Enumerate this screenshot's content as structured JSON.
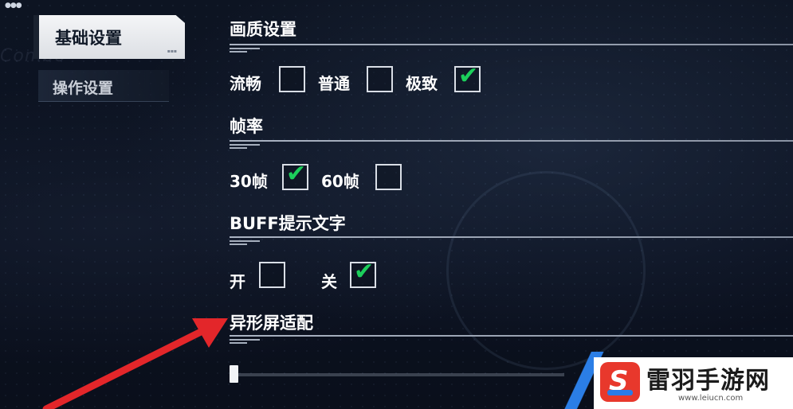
{
  "sidebar": {
    "items": [
      {
        "label": "基础设置",
        "active": true
      },
      {
        "label": "操作设置",
        "active": false
      }
    ]
  },
  "settings": {
    "quality": {
      "title": "画质设置",
      "options": [
        {
          "label": "流畅",
          "checked": false
        },
        {
          "label": "普通",
          "checked": false
        },
        {
          "label": "极致",
          "checked": true
        }
      ]
    },
    "framerate": {
      "title": "帧率",
      "options": [
        {
          "label": "30帧",
          "checked": true
        },
        {
          "label": "60帧",
          "checked": false
        }
      ]
    },
    "buff_text": {
      "title": "BUFF提示文字",
      "options": [
        {
          "label": "开",
          "checked": false
        },
        {
          "label": "关",
          "checked": true
        }
      ]
    },
    "notch_fit": {
      "title": "异形屏适配",
      "slider_value": 0
    }
  },
  "brand": {
    "name": "雷羽手游网",
    "url": "www.leiucn.com"
  },
  "colors": {
    "check": "#1ccf5b",
    "annotation_arrow": "#e3262a",
    "brand_red": "#e8382c",
    "brand_blue": "#2a7be8"
  }
}
